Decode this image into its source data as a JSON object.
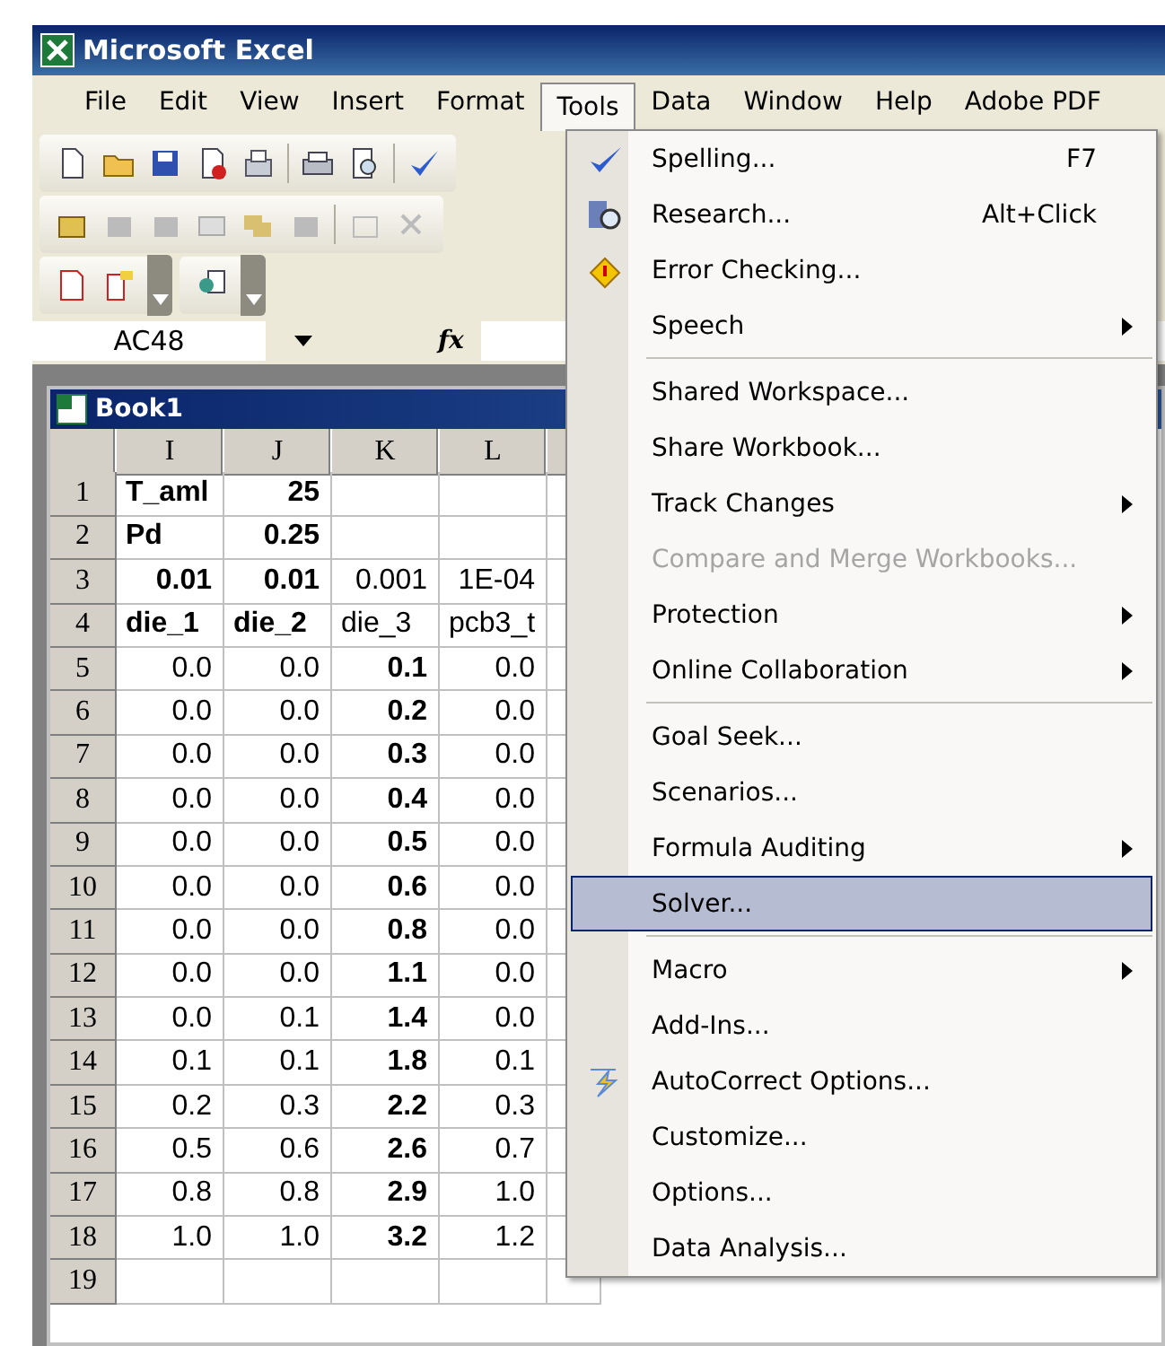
{
  "window": {
    "title": "Microsoft Excel"
  },
  "menu_bar": [
    {
      "label": "File",
      "selected": false
    },
    {
      "label": "Edit",
      "selected": false
    },
    {
      "label": "View",
      "selected": false
    },
    {
      "label": "Insert",
      "selected": false
    },
    {
      "label": "Format",
      "selected": false
    },
    {
      "label": "Tools",
      "selected": true
    },
    {
      "label": "Data",
      "selected": false
    },
    {
      "label": "Window",
      "selected": false
    },
    {
      "label": "Help",
      "selected": false
    },
    {
      "label": "Adobe PDF",
      "selected": false
    }
  ],
  "formula_bar": {
    "name_box": "AC48",
    "fx": "fx"
  },
  "workbook": {
    "title": "Book1",
    "columns": [
      "I",
      "J",
      "K",
      "L"
    ],
    "rows": [
      {
        "header": "1",
        "cells": [
          {
            "text": "T_aml",
            "bold": true,
            "kind": "text"
          },
          {
            "text": "25",
            "bold": true,
            "kind": "number"
          }
        ]
      },
      {
        "header": "2",
        "cells": [
          {
            "text": "Pd",
            "bold": true,
            "kind": "text"
          },
          {
            "text": "0.25",
            "bold": true,
            "kind": "number"
          }
        ]
      },
      {
        "header": "3",
        "cells": [
          {
            "text": "0.01",
            "bold": true,
            "kind": "number"
          },
          {
            "text": "0.01",
            "bold": true,
            "kind": "number"
          },
          {
            "text": "0.001",
            "bold": false,
            "kind": "number"
          },
          {
            "text": "1E-04",
            "bold": false,
            "kind": "number"
          }
        ]
      },
      {
        "header": "4",
        "cells": [
          {
            "text": "die_1",
            "bold": true,
            "kind": "text"
          },
          {
            "text": "die_2",
            "bold": true,
            "kind": "text"
          },
          {
            "text": "die_3",
            "bold": false,
            "kind": "text"
          },
          {
            "text": "pcb3_t",
            "bold": false,
            "kind": "text"
          }
        ]
      },
      {
        "header": "5",
        "cells": [
          {
            "text": "0.0",
            "bold": false,
            "kind": "number"
          },
          {
            "text": "0.0",
            "bold": false,
            "kind": "number"
          },
          {
            "text": "0.1",
            "bold": true,
            "kind": "number"
          },
          {
            "text": "0.0",
            "bold": false,
            "kind": "number"
          }
        ]
      },
      {
        "header": "6",
        "cells": [
          {
            "text": "0.0",
            "bold": false,
            "kind": "number"
          },
          {
            "text": "0.0",
            "bold": false,
            "kind": "number"
          },
          {
            "text": "0.2",
            "bold": true,
            "kind": "number"
          },
          {
            "text": "0.0",
            "bold": false,
            "kind": "number"
          }
        ]
      },
      {
        "header": "7",
        "cells": [
          {
            "text": "0.0",
            "bold": false,
            "kind": "number"
          },
          {
            "text": "0.0",
            "bold": false,
            "kind": "number"
          },
          {
            "text": "0.3",
            "bold": true,
            "kind": "number"
          },
          {
            "text": "0.0",
            "bold": false,
            "kind": "number"
          }
        ]
      },
      {
        "header": "8",
        "cells": [
          {
            "text": "0.0",
            "bold": false,
            "kind": "number"
          },
          {
            "text": "0.0",
            "bold": false,
            "kind": "number"
          },
          {
            "text": "0.4",
            "bold": true,
            "kind": "number"
          },
          {
            "text": "0.0",
            "bold": false,
            "kind": "number"
          }
        ]
      },
      {
        "header": "9",
        "cells": [
          {
            "text": "0.0",
            "bold": false,
            "kind": "number"
          },
          {
            "text": "0.0",
            "bold": false,
            "kind": "number"
          },
          {
            "text": "0.5",
            "bold": true,
            "kind": "number"
          },
          {
            "text": "0.0",
            "bold": false,
            "kind": "number"
          }
        ]
      },
      {
        "header": "10",
        "cells": [
          {
            "text": "0.0",
            "bold": false,
            "kind": "number"
          },
          {
            "text": "0.0",
            "bold": false,
            "kind": "number"
          },
          {
            "text": "0.6",
            "bold": true,
            "kind": "number"
          },
          {
            "text": "0.0",
            "bold": false,
            "kind": "number"
          }
        ]
      },
      {
        "header": "11",
        "cells": [
          {
            "text": "0.0",
            "bold": false,
            "kind": "number"
          },
          {
            "text": "0.0",
            "bold": false,
            "kind": "number"
          },
          {
            "text": "0.8",
            "bold": true,
            "kind": "number"
          },
          {
            "text": "0.0",
            "bold": false,
            "kind": "number"
          }
        ]
      },
      {
        "header": "12",
        "cells": [
          {
            "text": "0.0",
            "bold": false,
            "kind": "number"
          },
          {
            "text": "0.0",
            "bold": false,
            "kind": "number"
          },
          {
            "text": "1.1",
            "bold": true,
            "kind": "number"
          },
          {
            "text": "0.0",
            "bold": false,
            "kind": "number"
          }
        ]
      },
      {
        "header": "13",
        "cells": [
          {
            "text": "0.0",
            "bold": false,
            "kind": "number"
          },
          {
            "text": "0.1",
            "bold": false,
            "kind": "number"
          },
          {
            "text": "1.4",
            "bold": true,
            "kind": "number"
          },
          {
            "text": "0.0",
            "bold": false,
            "kind": "number"
          }
        ]
      },
      {
        "header": "14",
        "cells": [
          {
            "text": "0.1",
            "bold": false,
            "kind": "number"
          },
          {
            "text": "0.1",
            "bold": false,
            "kind": "number"
          },
          {
            "text": "1.8",
            "bold": true,
            "kind": "number"
          },
          {
            "text": "0.1",
            "bold": false,
            "kind": "number"
          }
        ]
      },
      {
        "header": "15",
        "cells": [
          {
            "text": "0.2",
            "bold": false,
            "kind": "number"
          },
          {
            "text": "0.3",
            "bold": false,
            "kind": "number"
          },
          {
            "text": "2.2",
            "bold": true,
            "kind": "number"
          },
          {
            "text": "0.3",
            "bold": false,
            "kind": "number"
          }
        ]
      },
      {
        "header": "16",
        "cells": [
          {
            "text": "0.5",
            "bold": false,
            "kind": "number"
          },
          {
            "text": "0.6",
            "bold": false,
            "kind": "number"
          },
          {
            "text": "2.6",
            "bold": true,
            "kind": "number"
          },
          {
            "text": "0.7",
            "bold": false,
            "kind": "number"
          }
        ]
      },
      {
        "header": "17",
        "cells": [
          {
            "text": "0.8",
            "bold": false,
            "kind": "number"
          },
          {
            "text": "0.8",
            "bold": false,
            "kind": "number"
          },
          {
            "text": "2.9",
            "bold": true,
            "kind": "number"
          },
          {
            "text": "1.0",
            "bold": false,
            "kind": "number"
          }
        ]
      },
      {
        "header": "18",
        "cells": [
          {
            "text": "1.0",
            "bold": false,
            "kind": "number"
          },
          {
            "text": "1.0",
            "bold": false,
            "kind": "number"
          },
          {
            "text": "3.2",
            "bold": true,
            "kind": "number"
          },
          {
            "text": "1.2",
            "bold": false,
            "kind": "number"
          }
        ]
      },
      {
        "header": "19"
      }
    ]
  },
  "tools_menu": [
    {
      "kind": "item",
      "label": "Spelling...",
      "shortcut": "F7",
      "submenu": false,
      "disabled": false,
      "selected": false
    },
    {
      "kind": "item",
      "label": "Research...",
      "shortcut": "Alt+Click",
      "submenu": false,
      "disabled": false,
      "selected": false
    },
    {
      "kind": "item",
      "label": "Error Checking...",
      "submenu": false,
      "disabled": false,
      "selected": false
    },
    {
      "kind": "item",
      "label": "Speech",
      "submenu": true,
      "disabled": false,
      "selected": false
    },
    {
      "kind": "separator"
    },
    {
      "kind": "item",
      "label": "Shared Workspace...",
      "submenu": false,
      "disabled": false,
      "selected": false
    },
    {
      "kind": "item",
      "label": "Share Workbook...",
      "submenu": false,
      "disabled": false,
      "selected": false
    },
    {
      "kind": "item",
      "label": "Track Changes",
      "submenu": true,
      "disabled": false,
      "selected": false
    },
    {
      "kind": "item",
      "label": "Compare and Merge Workbooks...",
      "submenu": false,
      "disabled": true,
      "selected": false
    },
    {
      "kind": "item",
      "label": "Protection",
      "submenu": true,
      "disabled": false,
      "selected": false
    },
    {
      "kind": "item",
      "label": "Online Collaboration",
      "submenu": true,
      "disabled": false,
      "selected": false
    },
    {
      "kind": "separator"
    },
    {
      "kind": "item",
      "label": "Goal Seek...",
      "submenu": false,
      "disabled": false,
      "selected": false
    },
    {
      "kind": "item",
      "label": "Scenarios...",
      "submenu": false,
      "disabled": false,
      "selected": false
    },
    {
      "kind": "item",
      "label": "Formula Auditing",
      "submenu": true,
      "disabled": false,
      "selected": false
    },
    {
      "kind": "item",
      "label": "Solver...",
      "submenu": false,
      "disabled": false,
      "selected": true
    },
    {
      "kind": "separator"
    },
    {
      "kind": "item",
      "label": "Macro",
      "submenu": true,
      "disabled": false,
      "selected": false
    },
    {
      "kind": "item",
      "label": "Add-Ins...",
      "submenu": false,
      "disabled": false,
      "selected": false
    },
    {
      "kind": "item",
      "label": "AutoCorrect Options...",
      "submenu": false,
      "disabled": false,
      "selected": false
    },
    {
      "kind": "item",
      "label": "Customize...",
      "submenu": false,
      "disabled": false,
      "selected": false
    },
    {
      "kind": "item",
      "label": "Options...",
      "submenu": false,
      "disabled": false,
      "selected": false
    },
    {
      "kind": "item",
      "label": "Data Analysis...",
      "submenu": false,
      "disabled": false,
      "selected": false
    }
  ]
}
